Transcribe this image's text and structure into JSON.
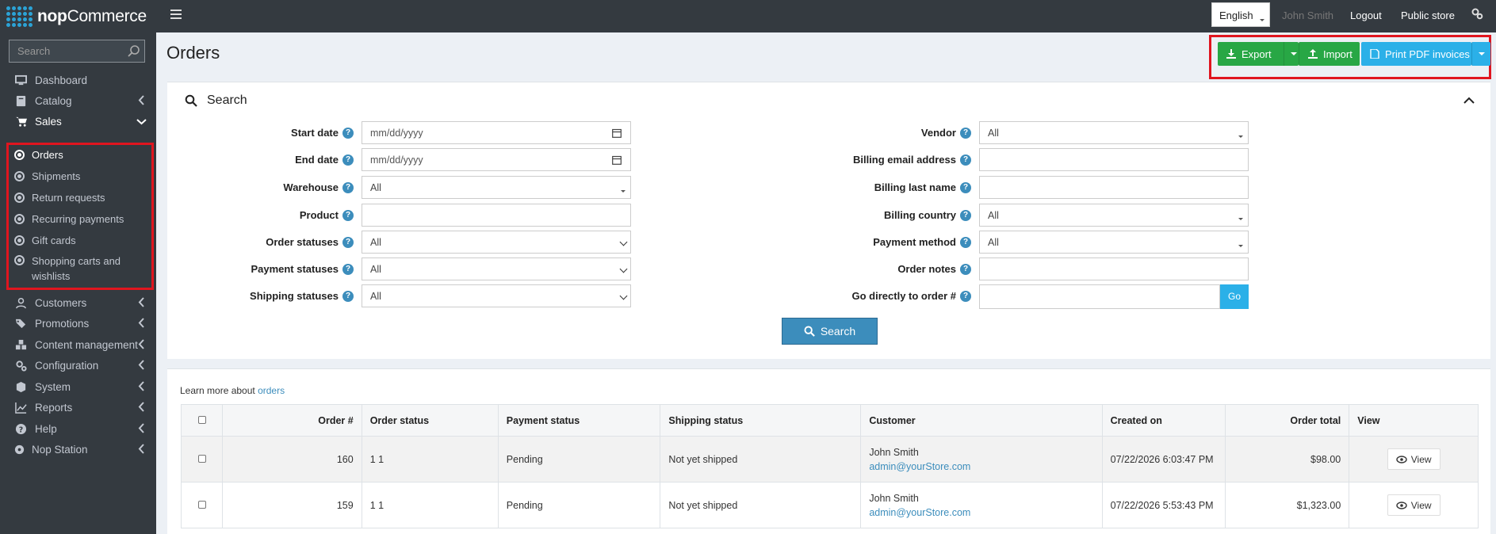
{
  "brand": {
    "logo_bold": "nop",
    "logo_rest": "Commerce"
  },
  "topbar": {
    "language": "English",
    "user": "John Smith",
    "logout": "Logout",
    "public_store": "Public store"
  },
  "sidebar": {
    "search_placeholder": "Search",
    "items": {
      "dashboard": "Dashboard",
      "catalog": "Catalog",
      "sales": "Sales",
      "customers": "Customers",
      "promotions": "Promotions",
      "content": "Content management",
      "configuration": "Configuration",
      "system": "System",
      "reports": "Reports",
      "help": "Help",
      "nopstation": "Nop Station"
    },
    "sales_sub": {
      "orders": "Orders",
      "shipments": "Shipments",
      "returns": "Return requests",
      "recurring": "Recurring payments",
      "giftcards": "Gift cards",
      "carts_line1": "Shopping carts and",
      "carts_line2": "wishlists"
    }
  },
  "page": {
    "title": "Orders",
    "export": "Export",
    "import": "Import",
    "print_pdf": "Print PDF invoices"
  },
  "search": {
    "heading": "Search",
    "button": "Search",
    "labels": {
      "start_date": "Start date",
      "end_date": "End date",
      "warehouse": "Warehouse",
      "product": "Product",
      "order_statuses": "Order statuses",
      "payment_statuses": "Payment statuses",
      "shipping_statuses": "Shipping statuses",
      "vendor": "Vendor",
      "billing_email": "Billing email address",
      "billing_last_name": "Billing last name",
      "billing_country": "Billing country",
      "payment_method": "Payment method",
      "order_notes": "Order notes",
      "go_directly": "Go directly to order #"
    },
    "values": {
      "date_placeholder": "mm/dd/yyyy",
      "all": "All",
      "go": "Go"
    }
  },
  "orders": {
    "learn_prefix": "Learn more about",
    "learn_link": "orders",
    "columns": {
      "order_no": "Order #",
      "order_status": "Order status",
      "payment_status": "Payment status",
      "shipping_status": "Shipping status",
      "customer": "Customer",
      "created_on": "Created on",
      "order_total": "Order total",
      "view": "View"
    },
    "rows": [
      {
        "id": "160",
        "status": "1 1",
        "payment": "Pending",
        "shipping": "Not yet shipped",
        "customer_name": "John Smith",
        "customer_email": "admin@yourStore.com",
        "created": "07/22/2026 6:03:47 PM",
        "total": "$98.00",
        "view": "View"
      },
      {
        "id": "159",
        "status": "1 1",
        "payment": "Pending",
        "shipping": "Not yet shipped",
        "customer_name": "John Smith",
        "customer_email": "admin@yourStore.com",
        "created": "07/22/2026 5:53:43 PM",
        "total": "$1,323.00",
        "view": "View"
      }
    ]
  },
  "colors": {
    "sidebar_bg": "#343a40",
    "accent_blue": "#3c8dbc",
    "export_green": "#28a745",
    "print_blue": "#2bb0e8",
    "highlight_red": "#e0151f"
  }
}
